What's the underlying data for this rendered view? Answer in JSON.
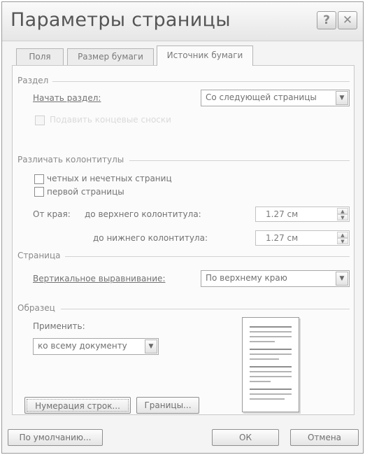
{
  "dialog": {
    "title": "Параметры страницы",
    "help_label": "?",
    "close_label": "✕"
  },
  "tabs": [
    {
      "label": "Поля"
    },
    {
      "label": "Размер бумаги"
    },
    {
      "label": "Источник бумаги"
    }
  ],
  "section": {
    "group_label": "Раздел",
    "start_label": "Начать раздел:",
    "start_value": "Со следующей страницы",
    "endnotes_label": "Подавить концевые сноски"
  },
  "headers": {
    "group_label": "Различать колонтитулы",
    "odd_even_label": "четных и нечетных страниц",
    "first_page_label": "первой страницы",
    "from_edge_label": "От края:",
    "header_label": "до верхнего колонтитула:",
    "header_value": "1.27 см",
    "footer_label": "до нижнего колонтитула:",
    "footer_value": "1.27 см"
  },
  "page": {
    "group_label": "Страница",
    "valign_label": "Вертикальное выравнивание:",
    "valign_value": "По верхнему краю"
  },
  "sample": {
    "group_label": "Образец",
    "apply_label": "Применить:",
    "apply_value": "ко всему документу"
  },
  "buttons": {
    "line_numbers": "Нумерация строк...",
    "borders": "Границы...",
    "default": "По умолчанию...",
    "ok": "ОК",
    "cancel": "Отмена"
  },
  "icons": {
    "dropdown": "chevron-down-icon",
    "spin_up": "arrow-up-icon",
    "spin_down": "arrow-down-icon",
    "close": "close-icon",
    "help": "help-icon"
  }
}
